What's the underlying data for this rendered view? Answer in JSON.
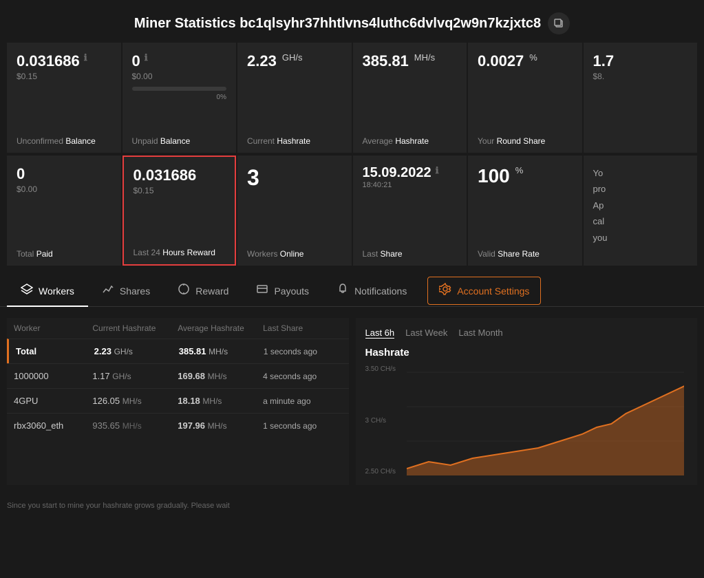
{
  "header": {
    "title": "Miner Statistics bc1qlsyhr37hhtlvns4luthc6dvlvq2w9n7kzjxtc8",
    "copy_icon": "📋"
  },
  "stats_row1": [
    {
      "id": "unconfirmed-balance",
      "value": "0.031686",
      "usd": "$0.15",
      "has_info": true,
      "label_normal": "Unconfirmed",
      "label_highlight": "Balance",
      "highlighted": false
    },
    {
      "id": "unpaid-balance",
      "value": "0",
      "usd": "$0.00",
      "has_info": true,
      "has_progress": true,
      "progress_pct": 0,
      "progress_label": "0%",
      "label_normal": "Unpaid",
      "label_highlight": "Balance",
      "highlighted": false
    },
    {
      "id": "current-hashrate",
      "value": "2.23",
      "unit": "GH/s",
      "label_normal": "Current",
      "label_highlight": "Hashrate",
      "highlighted": false
    },
    {
      "id": "average-hashrate",
      "value": "385.81",
      "unit": "MH/s",
      "label_normal": "Average",
      "label_highlight": "Hashrate",
      "highlighted": false
    },
    {
      "id": "round-share",
      "value": "0.0027",
      "unit": "%",
      "label_normal": "Your",
      "label_highlight": "Round Share",
      "highlighted": false
    },
    {
      "id": "partial-stat",
      "value": "1.7",
      "usd": "$8.",
      "partial": true,
      "label_normal": "",
      "label_highlight": "",
      "highlighted": false
    }
  ],
  "stats_row2": [
    {
      "id": "total-paid",
      "value": "0",
      "usd": "$0.00",
      "label_normal": "Total",
      "label_highlight": "Paid",
      "highlighted": false
    },
    {
      "id": "last-24h-reward",
      "value": "0.031686",
      "usd": "$0.15",
      "label_normal": "Last 24",
      "label_highlight": "Hours Reward",
      "highlighted": true
    },
    {
      "id": "workers-online",
      "value": "3",
      "label_normal": "Workers",
      "label_highlight": "Online",
      "highlighted": false
    },
    {
      "id": "last-share",
      "value": "15.09.2022",
      "sub": "18:40:21",
      "has_info": true,
      "label_normal": "Last",
      "label_highlight": "Share",
      "highlighted": false
    },
    {
      "id": "valid-share-rate",
      "value": "100",
      "unit": "%",
      "label_normal": "Valid",
      "label_highlight": "Share Rate",
      "highlighted": false
    },
    {
      "id": "partial-stat2",
      "value": "Yo",
      "sub_lines": [
        "pro",
        "",
        "Ap",
        "cal",
        "you"
      ],
      "partial": true,
      "label_normal": "",
      "label_highlight": "",
      "highlighted": false
    }
  ],
  "tabs": [
    {
      "id": "workers",
      "label": "Workers",
      "icon": "layers",
      "active": true
    },
    {
      "id": "shares",
      "label": "Shares",
      "icon": "shares",
      "active": false
    },
    {
      "id": "reward",
      "label": "Reward",
      "icon": "reward",
      "active": false
    },
    {
      "id": "payouts",
      "label": "Payouts",
      "icon": "payouts",
      "active": false
    },
    {
      "id": "notifications",
      "label": "Notifications",
      "icon": "bell",
      "active": false
    },
    {
      "id": "account-settings",
      "label": "Account Settings",
      "icon": "gear",
      "active": false,
      "special": true
    }
  ],
  "workers_table": {
    "columns": [
      "Worker",
      "Current Hashrate",
      "Average Hashrate",
      "Last Share"
    ],
    "total_row": {
      "name": "Total",
      "current_hashrate": "2.23",
      "current_unit": "GH/s",
      "avg_hashrate": "385.81",
      "avg_unit": "MH/s",
      "last_share": "1 seconds ago"
    },
    "rows": [
      {
        "name": "1000000",
        "current_hashrate": "1.17",
        "current_unit": "GH/s",
        "avg_hashrate": "169.68",
        "avg_unit": "MH/s",
        "last_share": "4 seconds ago"
      },
      {
        "name": "4GPU",
        "current_hashrate": "126.05",
        "current_unit": "MH/s",
        "avg_hashrate": "18.18",
        "avg_unit": "MH/s",
        "last_share": "a minute ago"
      },
      {
        "name": "rbx3060_eth",
        "current_hashrate": "935.65",
        "current_unit": "MH/s",
        "avg_hashrate": "197.96",
        "avg_unit": "MH/s",
        "last_share": "1 seconds ago"
      }
    ]
  },
  "hashrate_chart": {
    "filters": [
      "Last 6h",
      "Last Week",
      "Last Month"
    ],
    "active_filter": "Last 6h",
    "title": "Hashrate",
    "y_labels": [
      "3.50 CH/s",
      "3 CH/s",
      "2.50 CH/s"
    ],
    "accent_color": "#e07020"
  },
  "bottom_note": "Since you start to mine your hashrate grows gradually. Please wait",
  "colors": {
    "bg": "#1a1a1a",
    "card_bg": "#252525",
    "accent_orange": "#e07020",
    "highlight_red": "#e53e3e",
    "text_muted": "#888888",
    "text_light": "#ffffff"
  }
}
